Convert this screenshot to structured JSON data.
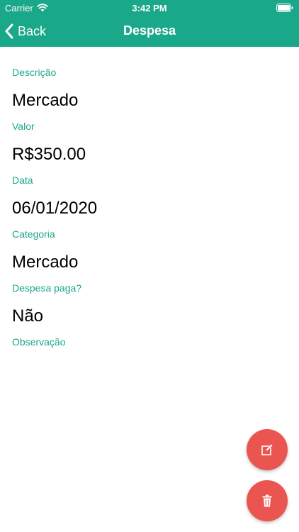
{
  "status_bar": {
    "carrier": "Carrier",
    "time": "3:42 PM",
    "wifi_icon": "wifi-icon",
    "battery_icon": "battery-icon"
  },
  "nav": {
    "back_label": "Back",
    "title": "Despesa",
    "back_icon": "chevron-left-icon"
  },
  "fields": [
    {
      "label": "Descrição",
      "value": "Mercado"
    },
    {
      "label": "Valor",
      "value": "R$350.00"
    },
    {
      "label": "Data",
      "value": "06/01/2020"
    },
    {
      "label": "Categoria",
      "value": "Mercado"
    },
    {
      "label": "Despesa paga?",
      "value": "Não"
    },
    {
      "label": "Observação",
      "value": ""
    }
  ],
  "actions": {
    "edit_icon": "edit-icon",
    "delete_icon": "trash-icon"
  },
  "colors": {
    "accent": "#1aa88a",
    "fab": "#ea5550",
    "text": "#000000",
    "bar_text": "#ffffff"
  }
}
